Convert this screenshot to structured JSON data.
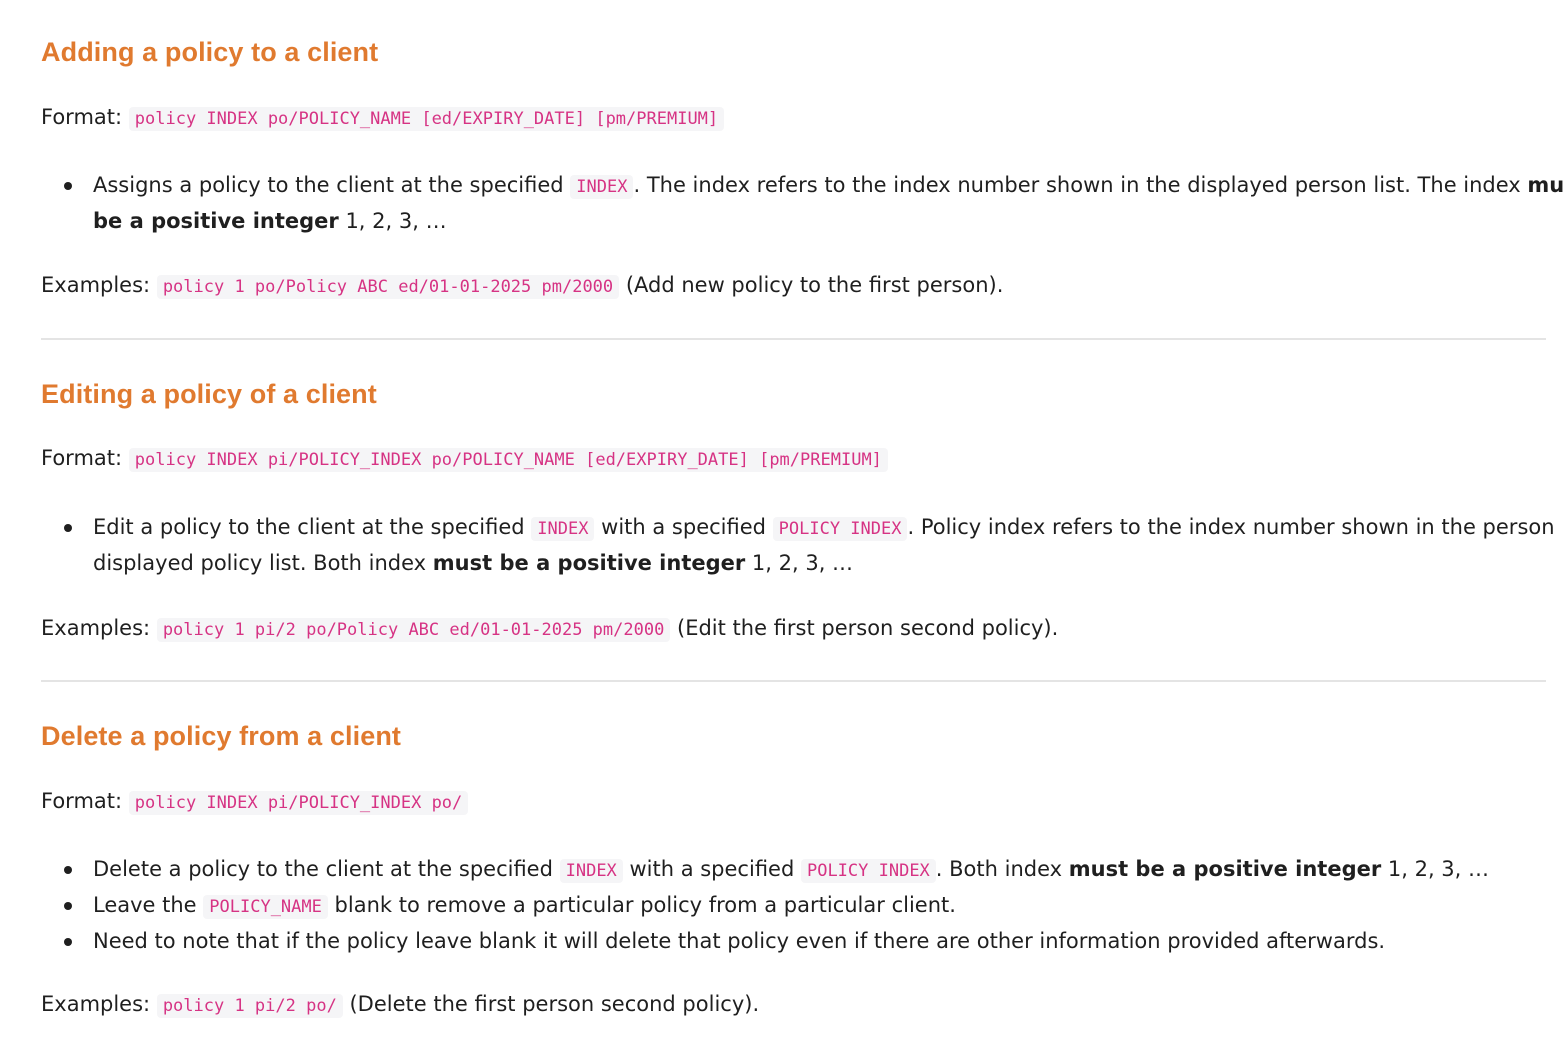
{
  "sections": [
    {
      "title": "Adding a policy to a client",
      "format_label": "Format:",
      "format_code": "policy INDEX po/POLICY_NAME [ed/EXPIRY_DATE] [pm/PREMIUM]",
      "bullet1": {
        "t1": "Assigns a policy to the client at the specified ",
        "c1": "INDEX",
        "t2": ". The index refers to the index number shown in the displayed person list. The index ",
        "b1": "must be a positive integer",
        "t3": " 1, 2, 3, …"
      },
      "examples_label": "Examples:",
      "example_code": "policy 1 po/Policy ABC ed/01-01-2025 pm/2000",
      "example_text": " (Add new policy to the first person)."
    },
    {
      "title": "Editing a policy of a client",
      "format_label": "Format:",
      "format_code": "policy INDEX pi/POLICY_INDEX po/POLICY_NAME [ed/EXPIRY_DATE] [pm/PREMIUM]",
      "bullet1": {
        "t1": "Edit a policy to the client at the specified ",
        "c1": "INDEX",
        "t2": " with a specified ",
        "c2": "POLICY INDEX",
        "t3": ". Policy index refers to the index number shown in the person displayed policy list. Both index ",
        "b1": "must be a positive integer",
        "t4": " 1, 2, 3, …"
      },
      "examples_label": "Examples:",
      "example_code": "policy 1 pi/2 po/Policy ABC ed/01-01-2025 pm/2000",
      "example_text": " (Edit the first person second policy)."
    },
    {
      "title": "Delete a policy from a client",
      "format_label": "Format:",
      "format_code": "policy INDEX pi/POLICY_INDEX po/",
      "bullet1": {
        "t1": "Delete a policy to the client at the specified ",
        "c1": "INDEX",
        "t2": " with a specified ",
        "c2": "POLICY INDEX",
        "t3": ". Both index ",
        "b1": "must be a positive integer",
        "t4": " 1, 2, 3, …"
      },
      "bullet2": {
        "t1": "Leave the ",
        "c1": "POLICY_NAME",
        "t2": " blank to remove a particular policy from a particular client."
      },
      "bullet3": {
        "t1": "Need to note that if the policy leave blank it will delete that policy even if there are other information provided afterwards."
      },
      "examples_label": "Examples:",
      "example_code": "policy 1 pi/2 po/",
      "example_text": " (Delete the first person second policy)."
    }
  ],
  "colors": {
    "heading": "#e07a2f",
    "code_text": "#d63384",
    "code_bg": "#f5f5f7",
    "divider": "#e4e4e4"
  }
}
